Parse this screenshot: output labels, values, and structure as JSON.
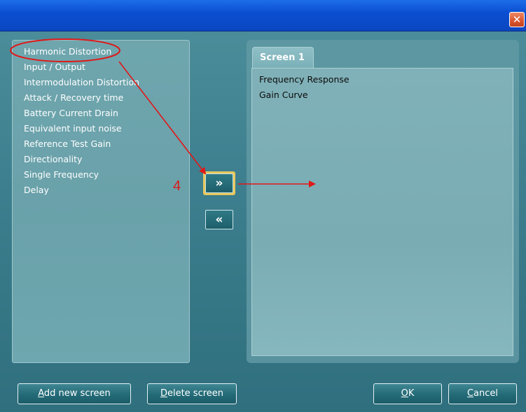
{
  "window": {
    "close_glyph": "✕"
  },
  "left_list": {
    "items": [
      {
        "label": "Harmonic Distortion"
      },
      {
        "label": "Input / Output"
      },
      {
        "label": "Intermodulation Distortion"
      },
      {
        "label": "Attack / Recovery time"
      },
      {
        "label": "Battery Current Drain"
      },
      {
        "label": "Equivalent input noise"
      },
      {
        "label": "Reference Test Gain"
      },
      {
        "label": "Directionality"
      },
      {
        "label": "Single Frequency"
      },
      {
        "label": "Delay"
      }
    ],
    "highlighted_index": 0
  },
  "move_buttons": {
    "add_glyph": "»",
    "remove_glyph": "«"
  },
  "right_panel": {
    "tab_label": "Screen 1",
    "items": [
      {
        "label": "Frequency Response"
      },
      {
        "label": "Gain Curve"
      }
    ]
  },
  "annotation": {
    "step_number": "4",
    "color": "#e01818"
  },
  "footer": {
    "add_screen": {
      "acc": "A",
      "rest": "dd new screen"
    },
    "delete_screen": {
      "acc": "D",
      "rest": "elete screen"
    },
    "ok": {
      "acc": "O",
      "rest": "K"
    },
    "cancel": {
      "acc": "C",
      "rest": "ancel"
    }
  },
  "colors": {
    "titlebar": "#0b4fd1",
    "dialog_bg": "#3d7f8e",
    "list_bg": "#6fa6ae",
    "button_highlight": "#e9c85c"
  }
}
